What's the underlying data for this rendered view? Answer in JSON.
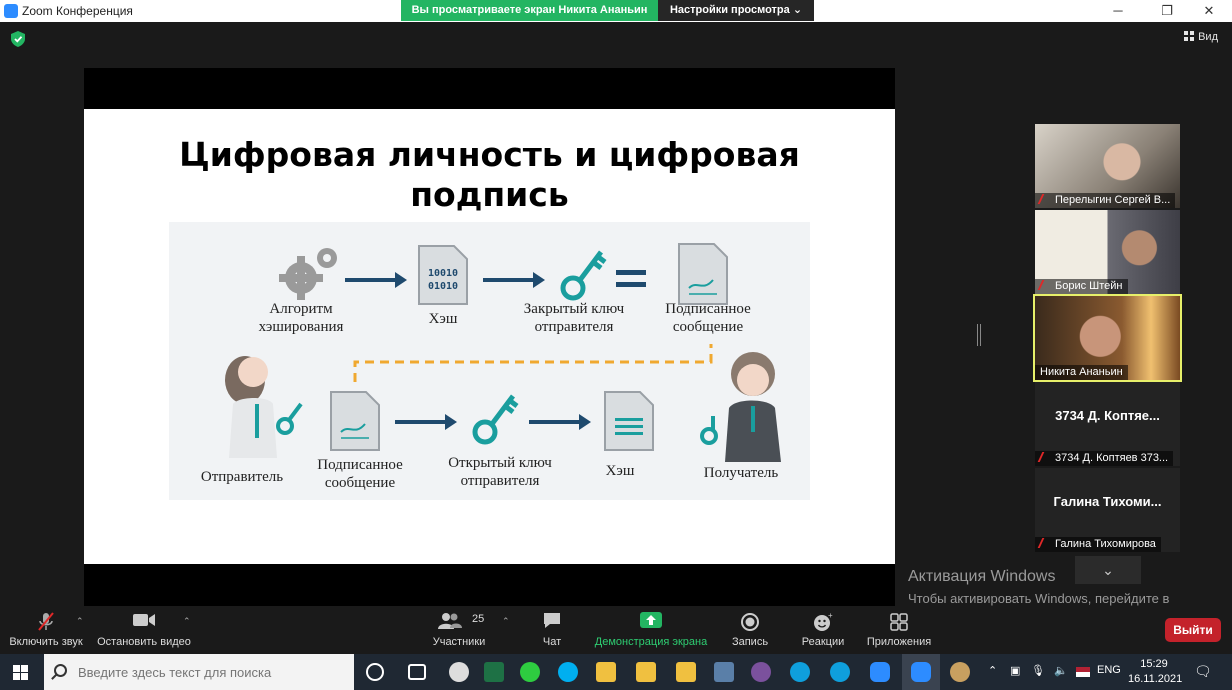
{
  "window": {
    "title": "Zoom Конференция",
    "minimize_glyph": "─",
    "maximize_glyph": "❐",
    "close_glyph": "✕"
  },
  "share_banner": {
    "text": "Вы просматриваете экран Никита Ананьин",
    "view_options": "Настройки просмотра ⌄"
  },
  "top_right": {
    "view_label": "Вид"
  },
  "slide": {
    "title": "Цифровая личность и цифровая подпись",
    "hash_bits": [
      "10010",
      "01010"
    ],
    "labels": {
      "hash_algorithm": "Алгоритм хэширования",
      "hash_top": "Хэш",
      "private_key": "Закрытый ключ отправителя",
      "signed_message_top": "Подписанное сообщение",
      "sender": "Отправитель",
      "signed_message_bottom": "Подписанное сообщение",
      "public_key": "Открытый ключ отправителя",
      "hash_bottom": "Хэш",
      "receiver": "Получатель"
    }
  },
  "participants": [
    {
      "name": "Перелыгин Сергей В..."
    },
    {
      "name": "Борис Штейн"
    },
    {
      "name": "Никита Ананьин",
      "active": true
    },
    {
      "display": "3734 Д. Коптяе...",
      "name": "3734 Д. Коптяев 373..."
    },
    {
      "display": "Галина  Тихоми...",
      "name": "Галина Тихомирова"
    }
  ],
  "activation": {
    "title": "Активация Windows",
    "text": "Чтобы активировать Windows, перейдите в раздел \"Параметры\"."
  },
  "toolbar": {
    "unmute": "Включить звук",
    "start_video": "Остановить видео",
    "participants": "Участники",
    "participants_count": "25",
    "chat": "Чат",
    "share_screen": "Демонстрация экрана",
    "record": "Запись",
    "reactions": "Реакции",
    "apps": "Приложения",
    "leave": "Выйти"
  },
  "taskbar": {
    "search_placeholder": "Введите здесь текст для поиска",
    "language": "ENG",
    "time": "15:29",
    "date": "16.11.2021"
  },
  "colors": {
    "share_green": "#23b562",
    "leave_red": "#c4222b",
    "diagram_teal": "#1a9e9e",
    "diagram_navy": "#1f4a6e",
    "dashed_orange": "#f0a830",
    "active_outline": "#e7f06a"
  }
}
